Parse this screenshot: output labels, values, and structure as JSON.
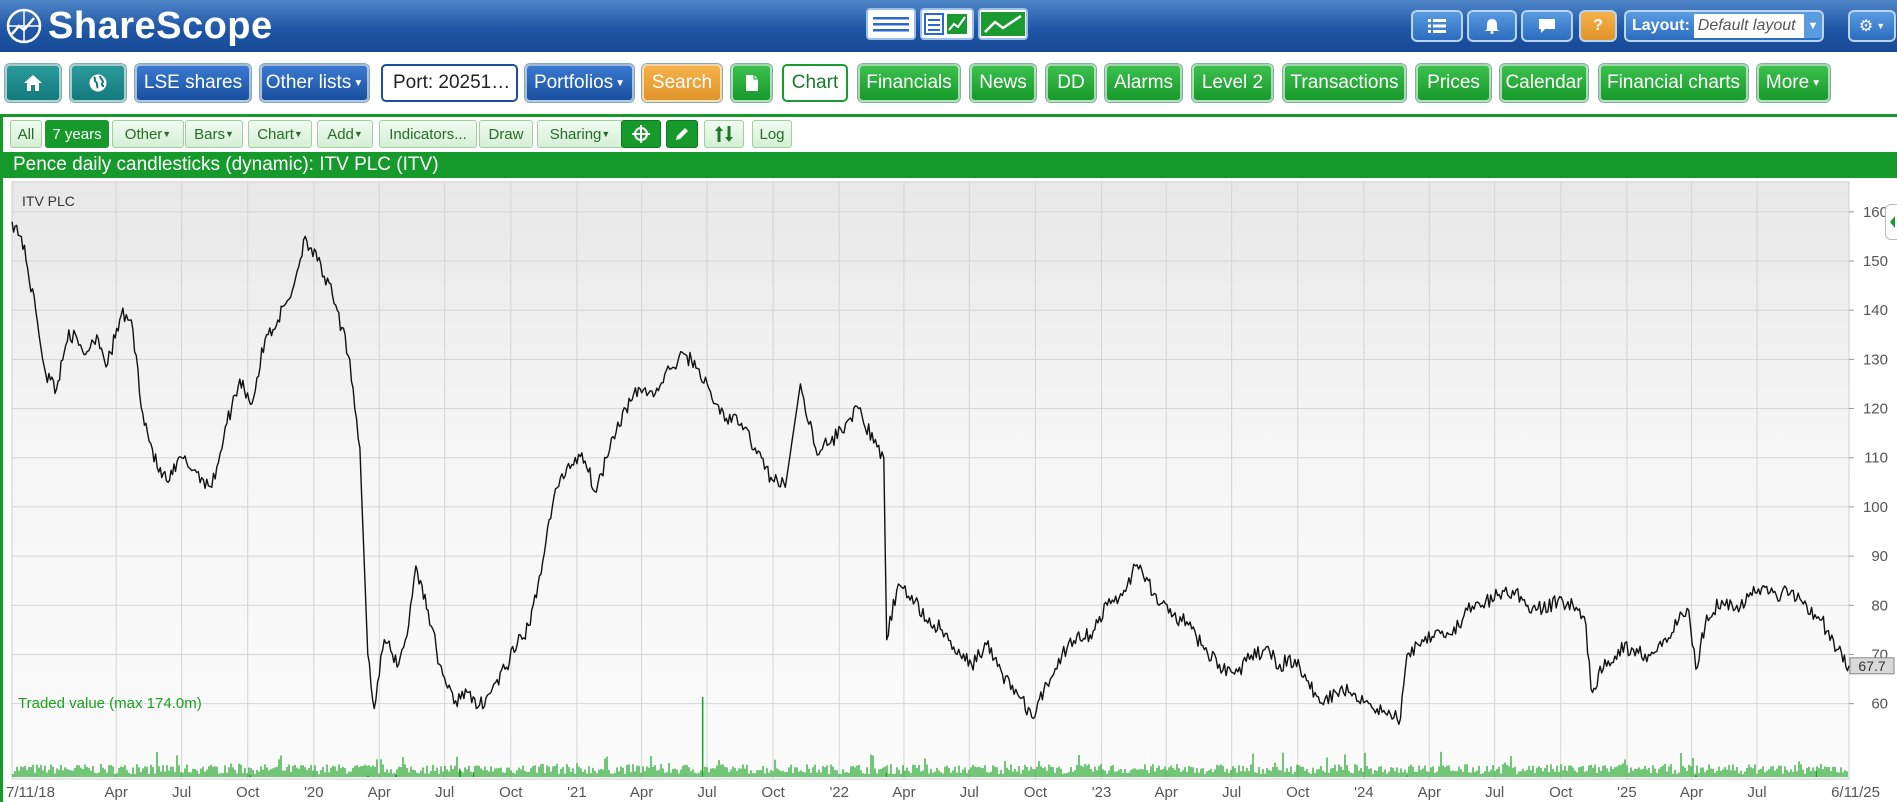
{
  "header": {
    "logo_text": "ShareScope",
    "layout_label": "Layout:",
    "layout_value": "Default layout",
    "help_label": "?"
  },
  "nav": {
    "lse_shares": "LSE shares",
    "other_lists": "Other lists",
    "portfolio_field": "Port: 20251…",
    "portfolios": "Portfolios",
    "search": "Search",
    "chart": "Chart",
    "financials": "Financials",
    "news": "News",
    "dd": "DD",
    "alarms": "Alarms",
    "level2": "Level 2",
    "transactions": "Transactions",
    "prices": "Prices",
    "calendar": "Calendar",
    "financial_charts": "Financial charts",
    "more": "More"
  },
  "toolbar": {
    "all": "All",
    "seven_years": "7 years",
    "other": "Other",
    "bars": "Bars",
    "chart": "Chart",
    "add": "Add",
    "indicators": "Indicators...",
    "draw": "Draw",
    "sharing": "Sharing",
    "log": "Log"
  },
  "chart_title": "Pence daily candlesticks (dynamic): ITV PLC (ITV)",
  "colors": {
    "topbar": "#1f56a6",
    "green": "#169a2c",
    "line": "#111111",
    "volume": "#17a21f",
    "plot_bg": "#f2f2f2"
  },
  "chart_data": {
    "type": "line",
    "series_label": "ITV PLC",
    "volume_label": "Traded value (max 174.0m)",
    "last_value_label": "67.7",
    "ylim": [
      52,
      162
    ],
    "yticks": [
      60,
      70,
      80,
      90,
      100,
      110,
      120,
      130,
      140,
      150,
      160
    ],
    "x_range": [
      "2018-11-07",
      "2025-11-06"
    ],
    "xticks": [
      {
        "date": "2018-11-07",
        "label": "7/11/18"
      },
      {
        "date": "2019-04-01",
        "label": "Apr"
      },
      {
        "date": "2019-07-01",
        "label": "Jul"
      },
      {
        "date": "2019-10-01",
        "label": "Oct"
      },
      {
        "date": "2020-01-01",
        "label": "'20"
      },
      {
        "date": "2020-04-01",
        "label": "Apr"
      },
      {
        "date": "2020-07-01",
        "label": "Jul"
      },
      {
        "date": "2020-10-01",
        "label": "Oct"
      },
      {
        "date": "2021-01-01",
        "label": "'21"
      },
      {
        "date": "2021-04-01",
        "label": "Apr"
      },
      {
        "date": "2021-07-01",
        "label": "Jul"
      },
      {
        "date": "2021-10-01",
        "label": "Oct"
      },
      {
        "date": "2022-01-01",
        "label": "'22"
      },
      {
        "date": "2022-04-01",
        "label": "Apr"
      },
      {
        "date": "2022-07-01",
        "label": "Jul"
      },
      {
        "date": "2022-10-01",
        "label": "Oct"
      },
      {
        "date": "2023-01-01",
        "label": "'23"
      },
      {
        "date": "2023-04-01",
        "label": "Apr"
      },
      {
        "date": "2023-07-01",
        "label": "Jul"
      },
      {
        "date": "2023-10-01",
        "label": "Oct"
      },
      {
        "date": "2024-01-01",
        "label": "'24"
      },
      {
        "date": "2024-04-01",
        "label": "Apr"
      },
      {
        "date": "2024-07-01",
        "label": "Jul"
      },
      {
        "date": "2024-10-01",
        "label": "Oct"
      },
      {
        "date": "2025-01-01",
        "label": "'25"
      },
      {
        "date": "2025-04-01",
        "label": "Apr"
      },
      {
        "date": "2025-07-01",
        "label": "Jul"
      },
      {
        "date": "2025-11-06",
        "label": "6/11/25"
      }
    ],
    "price_points": [
      [
        "2018-11-07",
        158
      ],
      [
        "2018-11-20",
        155
      ],
      [
        "2018-12-10",
        140
      ],
      [
        "2018-12-24",
        127
      ],
      [
        "2019-01-08",
        124
      ],
      [
        "2019-01-25",
        136
      ],
      [
        "2019-02-15",
        131
      ],
      [
        "2019-03-05",
        135
      ],
      [
        "2019-03-20",
        129
      ],
      [
        "2019-04-08",
        139
      ],
      [
        "2019-04-22",
        138
      ],
      [
        "2019-05-08",
        119
      ],
      [
        "2019-05-28",
        108
      ],
      [
        "2019-06-12",
        105
      ],
      [
        "2019-07-01",
        110
      ],
      [
        "2019-07-22",
        107
      ],
      [
        "2019-08-12",
        104
      ],
      [
        "2019-09-02",
        117
      ],
      [
        "2019-09-20",
        126
      ],
      [
        "2019-10-07",
        121
      ],
      [
        "2019-10-25",
        134
      ],
      [
        "2019-11-12",
        138
      ],
      [
        "2019-12-02",
        144
      ],
      [
        "2019-12-20",
        155
      ],
      [
        "2020-01-06",
        150
      ],
      [
        "2020-01-27",
        143
      ],
      [
        "2020-02-20",
        130
      ],
      [
        "2020-03-05",
        112
      ],
      [
        "2020-03-16",
        70
      ],
      [
        "2020-03-25",
        59
      ],
      [
        "2020-04-08",
        73
      ],
      [
        "2020-04-28",
        68
      ],
      [
        "2020-05-12",
        76
      ],
      [
        "2020-05-22",
        88
      ],
      [
        "2020-06-08",
        79
      ],
      [
        "2020-06-24",
        68
      ],
      [
        "2020-07-14",
        60
      ],
      [
        "2020-07-30",
        63
      ],
      [
        "2020-08-14",
        59
      ],
      [
        "2020-09-01",
        62
      ],
      [
        "2020-09-23",
        67
      ],
      [
        "2020-10-10",
        72
      ],
      [
        "2020-10-28",
        76
      ],
      [
        "2020-11-10",
        86
      ],
      [
        "2020-11-30",
        102
      ],
      [
        "2020-12-18",
        108
      ],
      [
        "2021-01-08",
        111
      ],
      [
        "2021-01-28",
        103
      ],
      [
        "2021-02-18",
        114
      ],
      [
        "2021-03-10",
        120
      ],
      [
        "2021-03-30",
        124
      ],
      [
        "2021-04-20",
        123
      ],
      [
        "2021-05-10",
        128
      ],
      [
        "2021-06-01",
        131
      ],
      [
        "2021-06-20",
        128
      ],
      [
        "2021-07-08",
        122
      ],
      [
        "2021-07-28",
        118
      ],
      [
        "2021-08-18",
        117
      ],
      [
        "2021-09-06",
        112
      ],
      [
        "2021-09-28",
        106
      ],
      [
        "2021-10-18",
        104
      ],
      [
        "2021-11-08",
        125
      ],
      [
        "2021-11-29",
        112
      ],
      [
        "2021-12-20",
        113
      ],
      [
        "2022-01-10",
        117
      ],
      [
        "2022-01-28",
        120
      ],
      [
        "2022-02-18",
        113
      ],
      [
        "2022-03-04",
        110
      ],
      [
        "2022-03-08",
        73
      ],
      [
        "2022-03-22",
        83
      ],
      [
        "2022-04-12",
        82
      ],
      [
        "2022-05-02",
        77
      ],
      [
        "2022-05-24",
        75
      ],
      [
        "2022-06-14",
        70
      ],
      [
        "2022-07-04",
        68
      ],
      [
        "2022-07-25",
        72
      ],
      [
        "2022-08-16",
        66
      ],
      [
        "2022-09-06",
        62
      ],
      [
        "2022-09-28",
        57
      ],
      [
        "2022-10-17",
        64
      ],
      [
        "2022-11-07",
        70
      ],
      [
        "2022-11-28",
        74
      ],
      [
        "2022-12-16",
        74
      ],
      [
        "2023-01-09",
        80
      ],
      [
        "2023-01-30",
        82
      ],
      [
        "2023-02-17",
        88
      ],
      [
        "2023-03-07",
        85
      ],
      [
        "2023-03-22",
        80
      ],
      [
        "2023-04-11",
        78
      ],
      [
        "2023-05-02",
        76
      ],
      [
        "2023-05-24",
        71
      ],
      [
        "2023-06-14",
        68
      ],
      [
        "2023-07-05",
        66
      ],
      [
        "2023-07-26",
        69
      ],
      [
        "2023-08-16",
        71
      ],
      [
        "2023-09-06",
        68
      ],
      [
        "2023-09-27",
        69
      ],
      [
        "2023-10-18",
        63
      ],
      [
        "2023-11-08",
        61
      ],
      [
        "2023-11-29",
        63
      ],
      [
        "2023-12-20",
        62
      ],
      [
        "2024-01-10",
        60
      ],
      [
        "2024-01-31",
        58
      ],
      [
        "2024-02-21",
        57
      ],
      [
        "2024-03-01",
        70
      ],
      [
        "2024-03-22",
        73
      ],
      [
        "2024-04-12",
        75
      ],
      [
        "2024-05-03",
        74
      ],
      [
        "2024-05-24",
        79
      ],
      [
        "2024-06-14",
        80
      ],
      [
        "2024-07-05",
        82
      ],
      [
        "2024-07-26",
        83
      ],
      [
        "2024-08-16",
        80
      ],
      [
        "2024-09-06",
        79
      ],
      [
        "2024-09-27",
        81
      ],
      [
        "2024-10-18",
        80
      ],
      [
        "2024-11-05",
        76
      ],
      [
        "2024-11-12",
        63
      ],
      [
        "2024-11-29",
        67
      ],
      [
        "2024-12-20",
        71
      ],
      [
        "2025-01-10",
        71
      ],
      [
        "2025-01-31",
        70
      ],
      [
        "2025-02-21",
        73
      ],
      [
        "2025-03-14",
        77
      ],
      [
        "2025-03-28",
        79
      ],
      [
        "2025-04-07",
        67
      ],
      [
        "2025-04-22",
        78
      ],
      [
        "2025-05-13",
        81
      ],
      [
        "2025-06-03",
        80
      ],
      [
        "2025-06-24",
        82
      ],
      [
        "2025-07-10",
        84
      ],
      [
        "2025-07-28",
        82
      ],
      [
        "2025-08-18",
        83
      ],
      [
        "2025-09-08",
        80
      ],
      [
        "2025-09-29",
        77
      ],
      [
        "2025-10-20",
        71
      ],
      [
        "2025-11-06",
        67.7
      ]
    ],
    "volume_spikes": [
      [
        "2019-10-04",
        3.7
      ],
      [
        "2020-03-16",
        2.8
      ],
      [
        "2020-04-24",
        4.4
      ],
      [
        "2020-07-22",
        18.2
      ],
      [
        "2020-08-10",
        11.0
      ],
      [
        "2021-06-25",
        174.0
      ],
      [
        "2022-03-08",
        8.8
      ],
      [
        "2024-03-01",
        4.0
      ],
      [
        "2025-04-07",
        3.4
      ],
      [
        "2025-09-22",
        13.8
      ]
    ]
  }
}
